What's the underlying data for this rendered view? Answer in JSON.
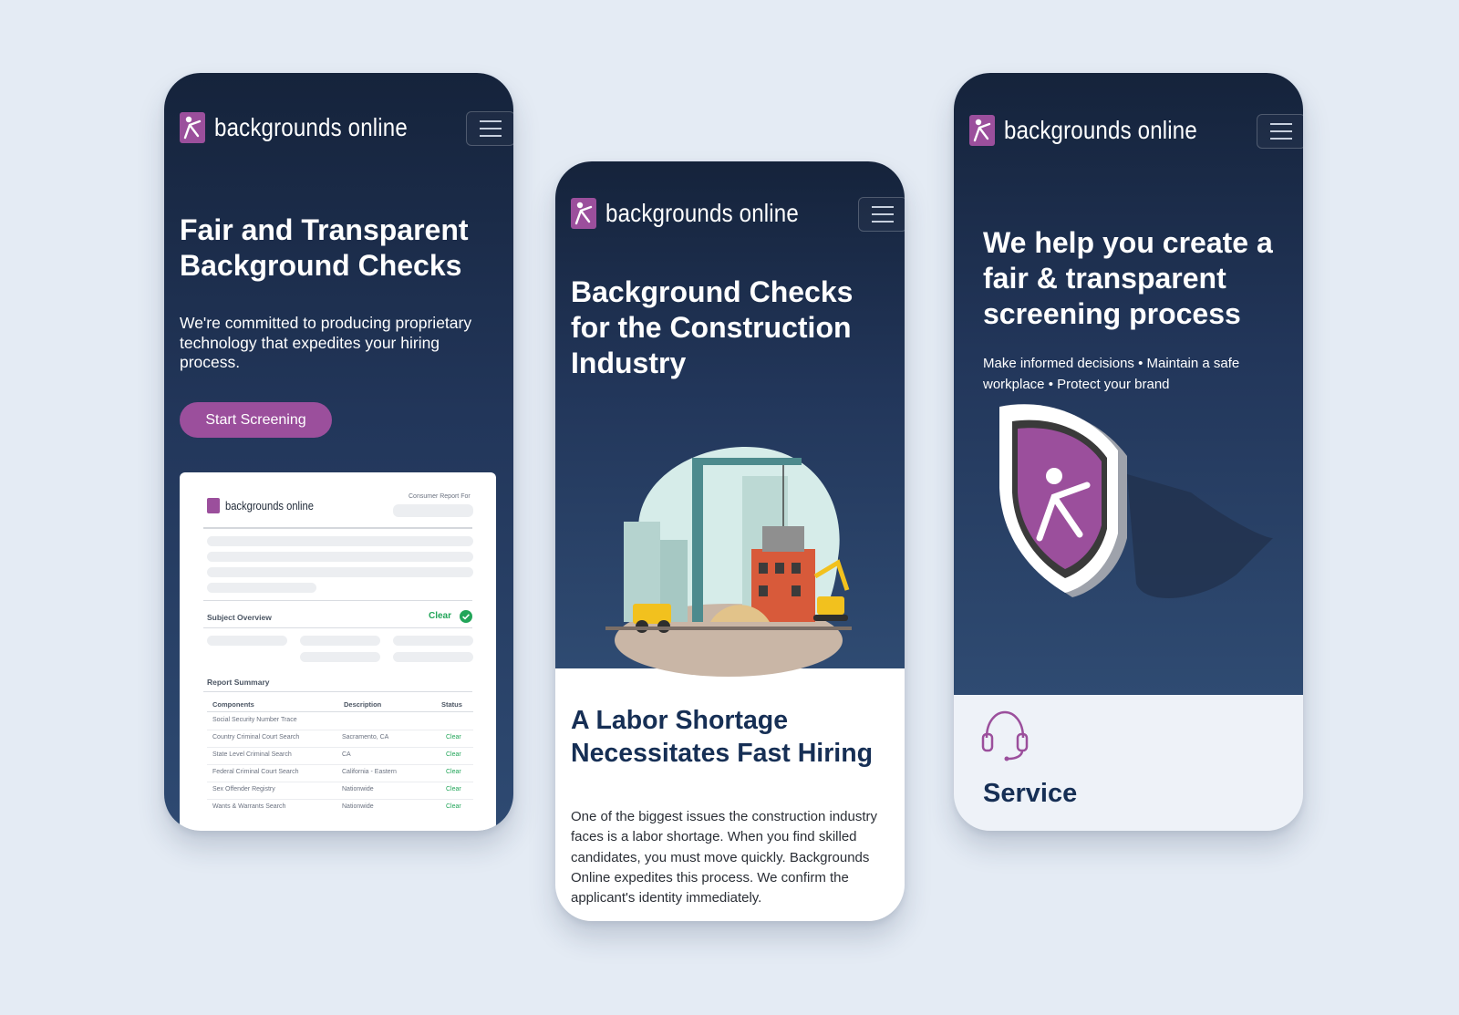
{
  "brand": {
    "name": "backgrounds online",
    "logo_color": "#9b4f9c"
  },
  "colors": {
    "background": "#e4ebf4",
    "hero_dark": "#15233b",
    "hero_light": "#2e4a72",
    "accent": "#9b4f9c",
    "heading_navy": "#162f55",
    "status_clear": "#22a559"
  },
  "phone1": {
    "title": "Fair and Transparent Background Checks",
    "subtitle": "We're committed to producing proprietary technology that expedites your hiring process.",
    "cta_label": "Start Screening",
    "report": {
      "brand": "backgrounds online",
      "consumer_report_for": "Consumer Report For",
      "subject_overview": "Subject Overview",
      "overview_status": "Clear",
      "report_summary": "Report Summary",
      "columns": [
        "Components",
        "Description",
        "Status"
      ],
      "rows": [
        {
          "component": "Social Security Number Trace",
          "description": "",
          "status": ""
        },
        {
          "component": "Country Criminal Court Search",
          "description": "Sacramento, CA",
          "status": "Clear"
        },
        {
          "component": "State Level Criminal Search",
          "description": "CA",
          "status": "Clear"
        },
        {
          "component": "Federal Criminal Court Search",
          "description": "California - Eastern",
          "status": "Clear"
        },
        {
          "component": "Sex Offender Registry",
          "description": "Nationwide",
          "status": "Clear"
        },
        {
          "component": "Wants & Warrants Search",
          "description": "Nationwide",
          "status": "Clear"
        }
      ]
    }
  },
  "phone2": {
    "title": "Background Checks for the Construction Industry",
    "section_title": "A Labor Shortage Necessitates Fast Hiring",
    "body": "One of the biggest issues the construction industry faces is a labor shortage. When you find skilled candidates, you must move quickly. Backgrounds Online expedites this process. We confirm the applicant's identity immediately."
  },
  "phone3": {
    "title": "We help you create a fair & transparent screening process",
    "subtitle": "Make informed decisions  •  Maintain a safe workplace  •  Protect your brand",
    "section_title": "Service",
    "service_icon": "headset-icon"
  },
  "icons": {
    "menu": "hamburger-menu-icon",
    "logo": "backgrounds-online-logo-icon",
    "check": "check-circle-icon",
    "shield": "shield-logo-icon"
  }
}
